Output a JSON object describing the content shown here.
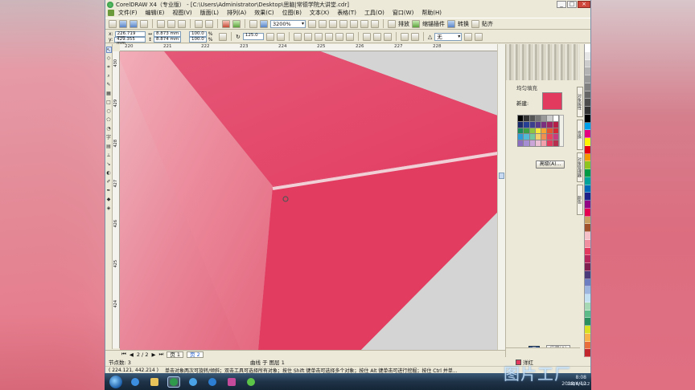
{
  "window": {
    "title": "CorelDRAW X4（专业版） - [C:\\Users\\Administrator\\Desktop\\思脑|常德学院大讲堂.cdr]",
    "min_label": "_",
    "max_label": "□",
    "close_label": "×"
  },
  "menu": {
    "items": [
      "文件(F)",
      "编辑(E)",
      "视图(V)",
      "版面(L)",
      "排列(A)",
      "效果(C)",
      "位图(B)",
      "文本(X)",
      "表格(T)",
      "工具(O)",
      "窗口(W)",
      "帮助(H)"
    ]
  },
  "toolbar": {
    "zoom_value": "3200%",
    "snap_label": "贴齐",
    "arrange_label": "排放",
    "plugin_label": "缩锚插件",
    "convert_label": "转换",
    "align_label": "贴齐"
  },
  "property_bar": {
    "x": "226.719 mm",
    "y": "429.355 mm",
    "w": "8.873 mm",
    "h": "8.874 mm",
    "scale_x": "100.0",
    "scale_y": "100.0",
    "percent": "%",
    "angle": "125.0",
    "outline": "无"
  },
  "rulers": {
    "h_ticks": [
      "220",
      "221",
      "222",
      "223",
      "224",
      "225",
      "226",
      "227",
      "228"
    ],
    "v_ticks": [
      "430",
      "429",
      "428",
      "427",
      "426",
      "425",
      "424"
    ]
  },
  "docker": {
    "title": "均匀填充",
    "new_label": "新建:",
    "advanced_button": "高级(A)...",
    "apply_button": "应用(A)",
    "tabs": [
      "对象属性",
      "变换",
      "对象管理器",
      "颜色"
    ]
  },
  "pages": {
    "counter": "2 / 2",
    "tab1": "页 1",
    "tab2": "页 2"
  },
  "status": {
    "nodes": "节点数: 3",
    "curve_info": "曲线 于 图层 1",
    "coords": "( 224.121, 442.214 )",
    "hint": "单击对象两次可旋转/倾斜；双击工具可选择所有对象；按住 Shift 键单击可选择多个对象；按住 Alt 键单击可进行挖掘；按住 Ctrl 并单...",
    "fill_label": "洋红"
  },
  "taskbar": {
    "time": "8:08",
    "date": "2018/4/12"
  },
  "watermark": {
    "text": "图片工厂",
    "date": "2018/4/12"
  },
  "colors": {
    "fill": "#e13a5e"
  }
}
